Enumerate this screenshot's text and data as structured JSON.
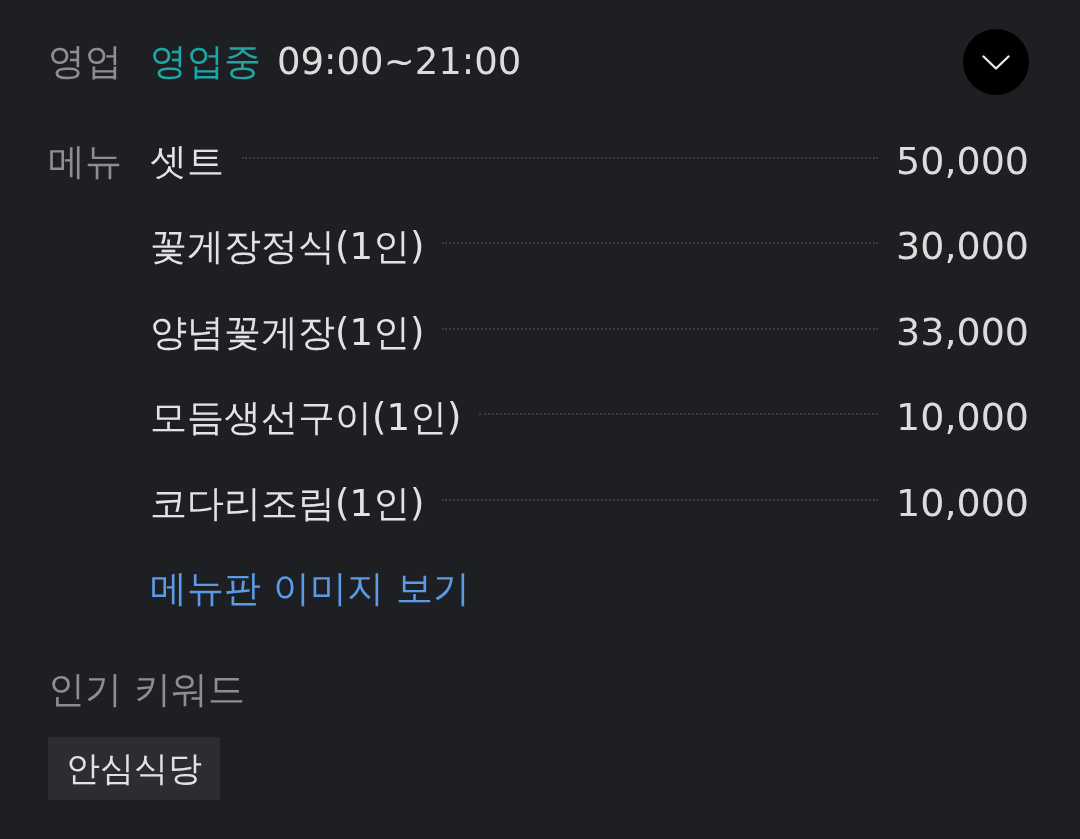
{
  "hours": {
    "label": "영업",
    "status": "영업중",
    "time": "09:00~21:00",
    "expanded": false
  },
  "menu": {
    "label": "메뉴",
    "items": [
      {
        "name": "셋트",
        "price": "50,000"
      },
      {
        "name": "꽃게장정식(1인)",
        "price": "30,000"
      },
      {
        "name": "양념꽃게장(1인)",
        "price": "33,000"
      },
      {
        "name": "모듬생선구이(1인)",
        "price": "10,000"
      },
      {
        "name": "코다리조림(1인)",
        "price": "10,000"
      }
    ],
    "link": "메뉴판 이미지 보기"
  },
  "keywords": {
    "title": "인기 키워드",
    "tags": [
      "안심식당"
    ]
  }
}
